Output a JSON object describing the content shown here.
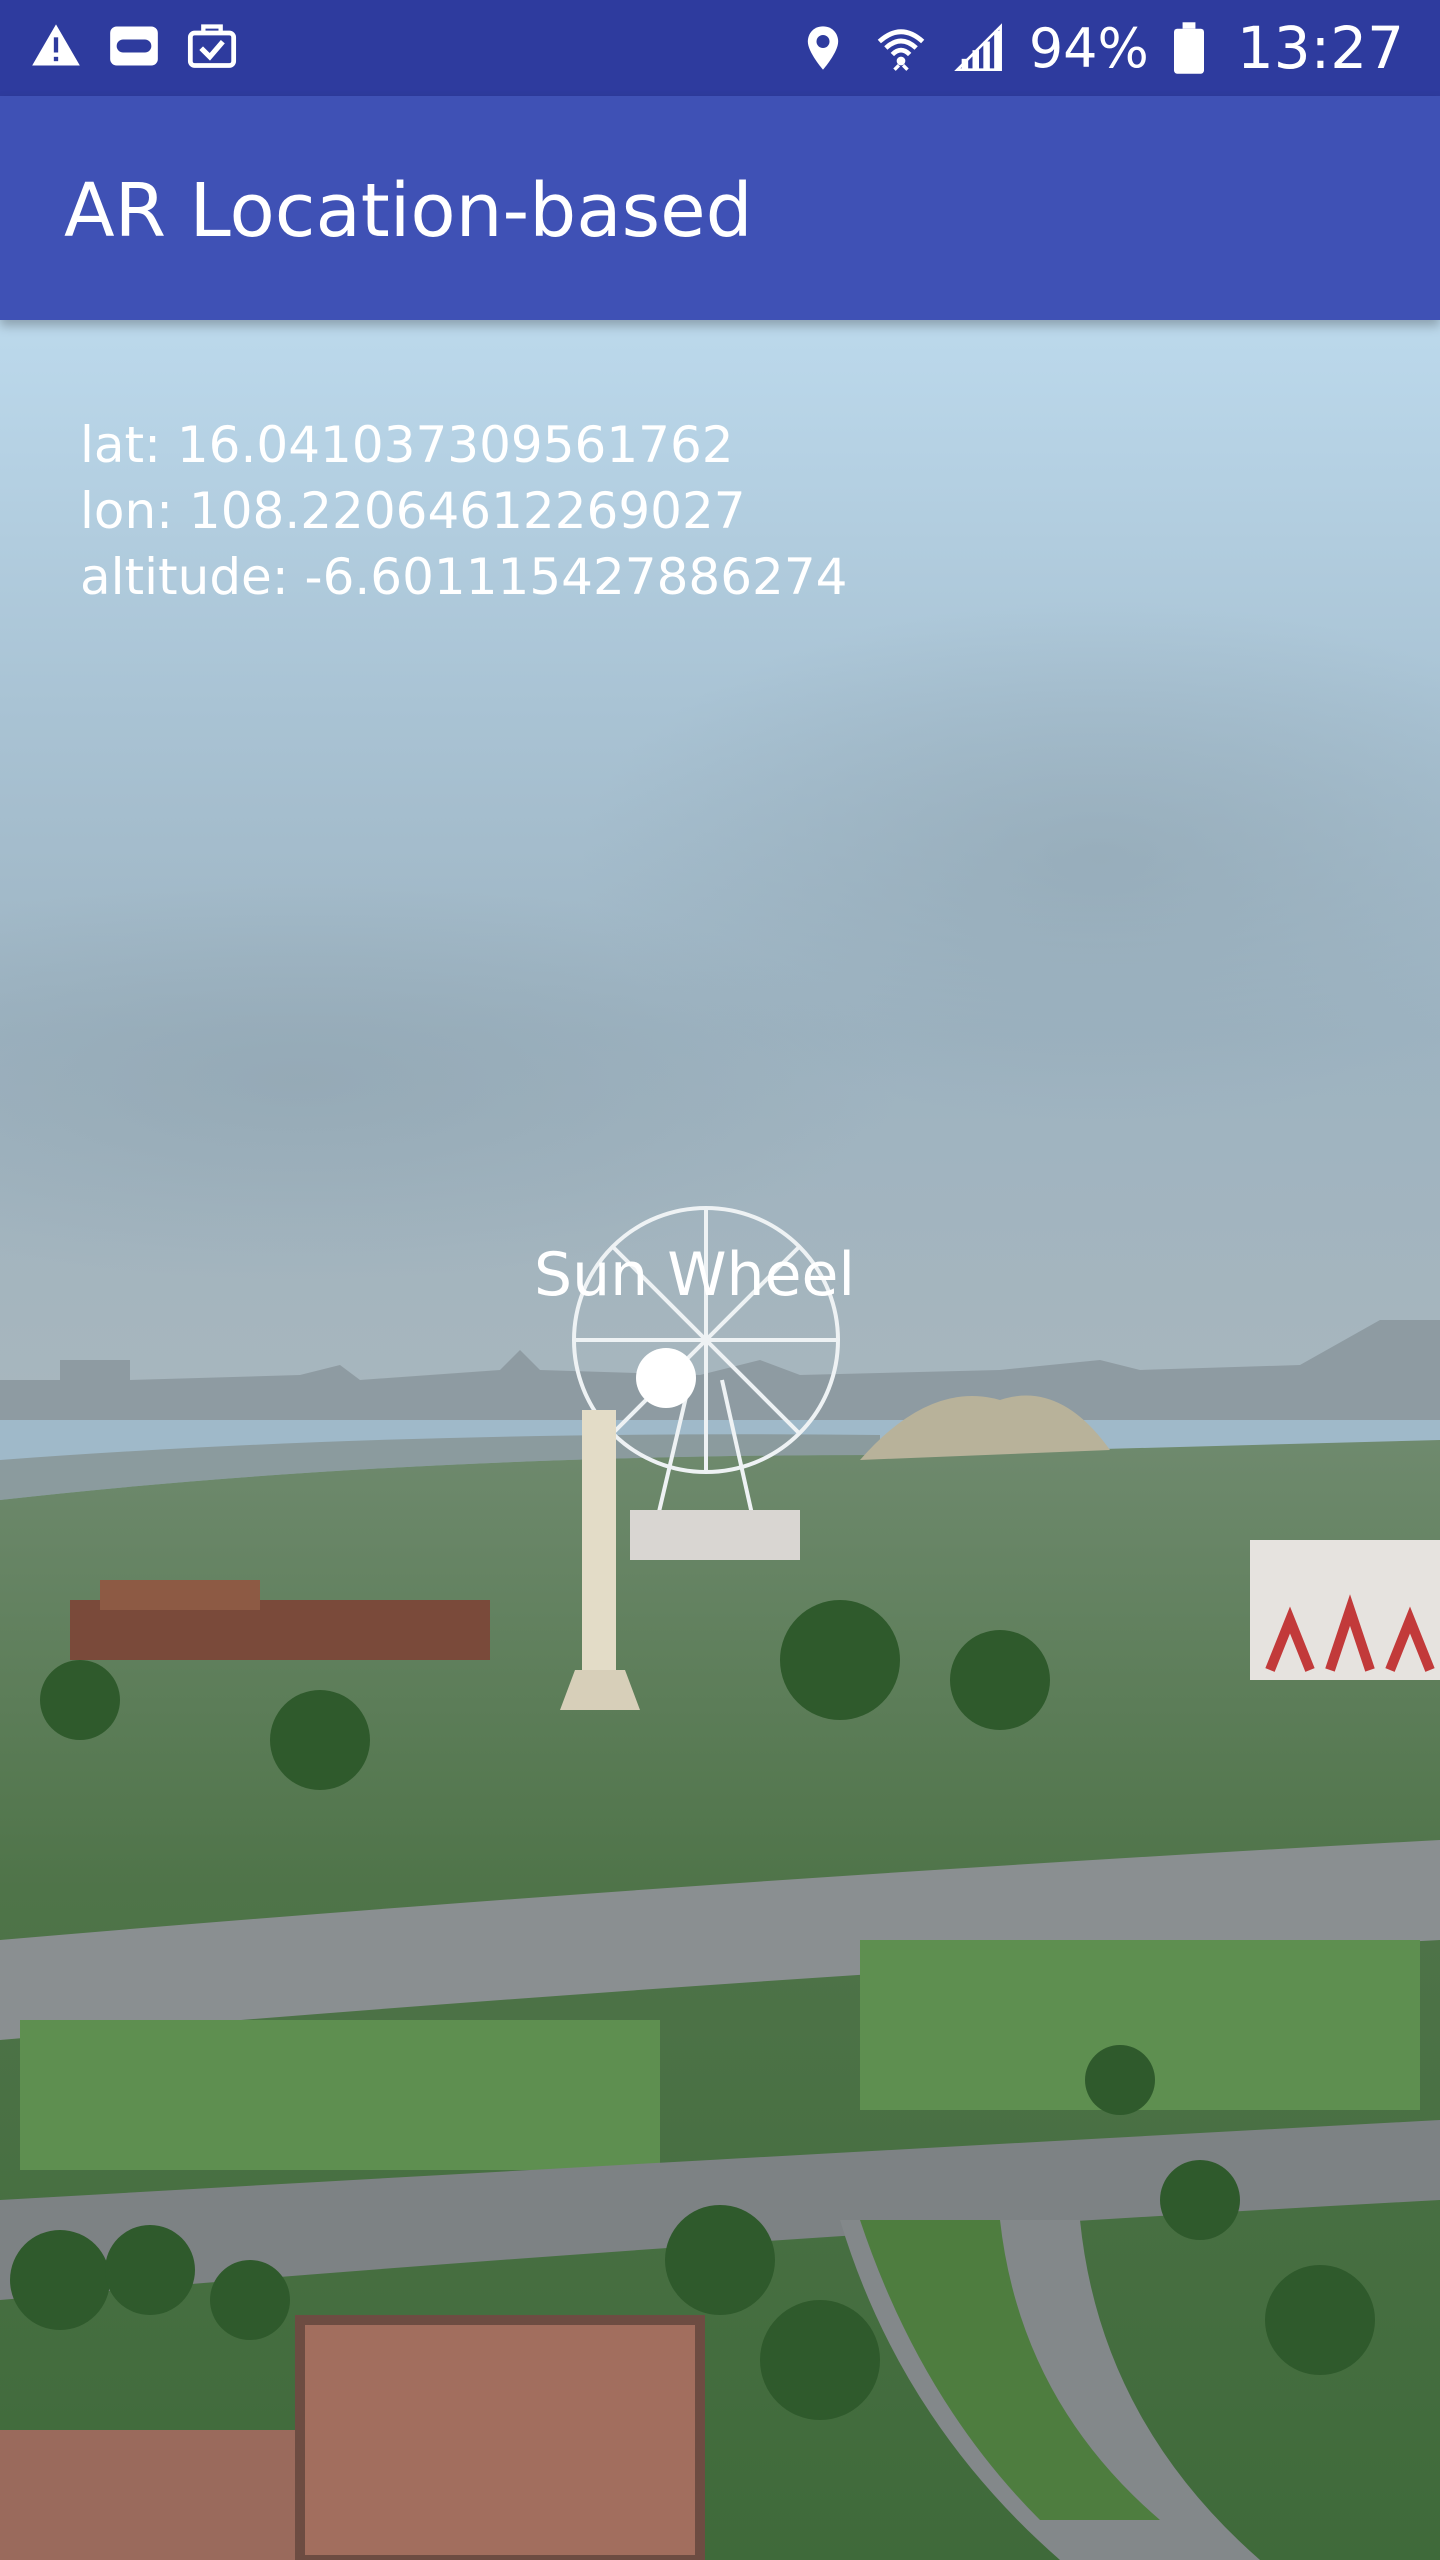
{
  "status_bar": {
    "left_icons": [
      "warning-icon",
      "vr-headset-icon",
      "briefcase-check-icon"
    ],
    "right_icons": [
      "location-icon",
      "wifi-icon",
      "cell-signal-icon",
      "battery-icon"
    ],
    "battery": "94%",
    "time": "13:27"
  },
  "app_bar": {
    "title": "AR Location-based",
    "color": "#3f51b5"
  },
  "location": {
    "lat": "lat: 16.041037309561762",
    "lon": "lon: 108.22064612269027",
    "altitude": "altitude: -6.601115427886274"
  },
  "poi": {
    "label": "Sun Wheel",
    "marker_icon": "poi-dot-icon"
  }
}
